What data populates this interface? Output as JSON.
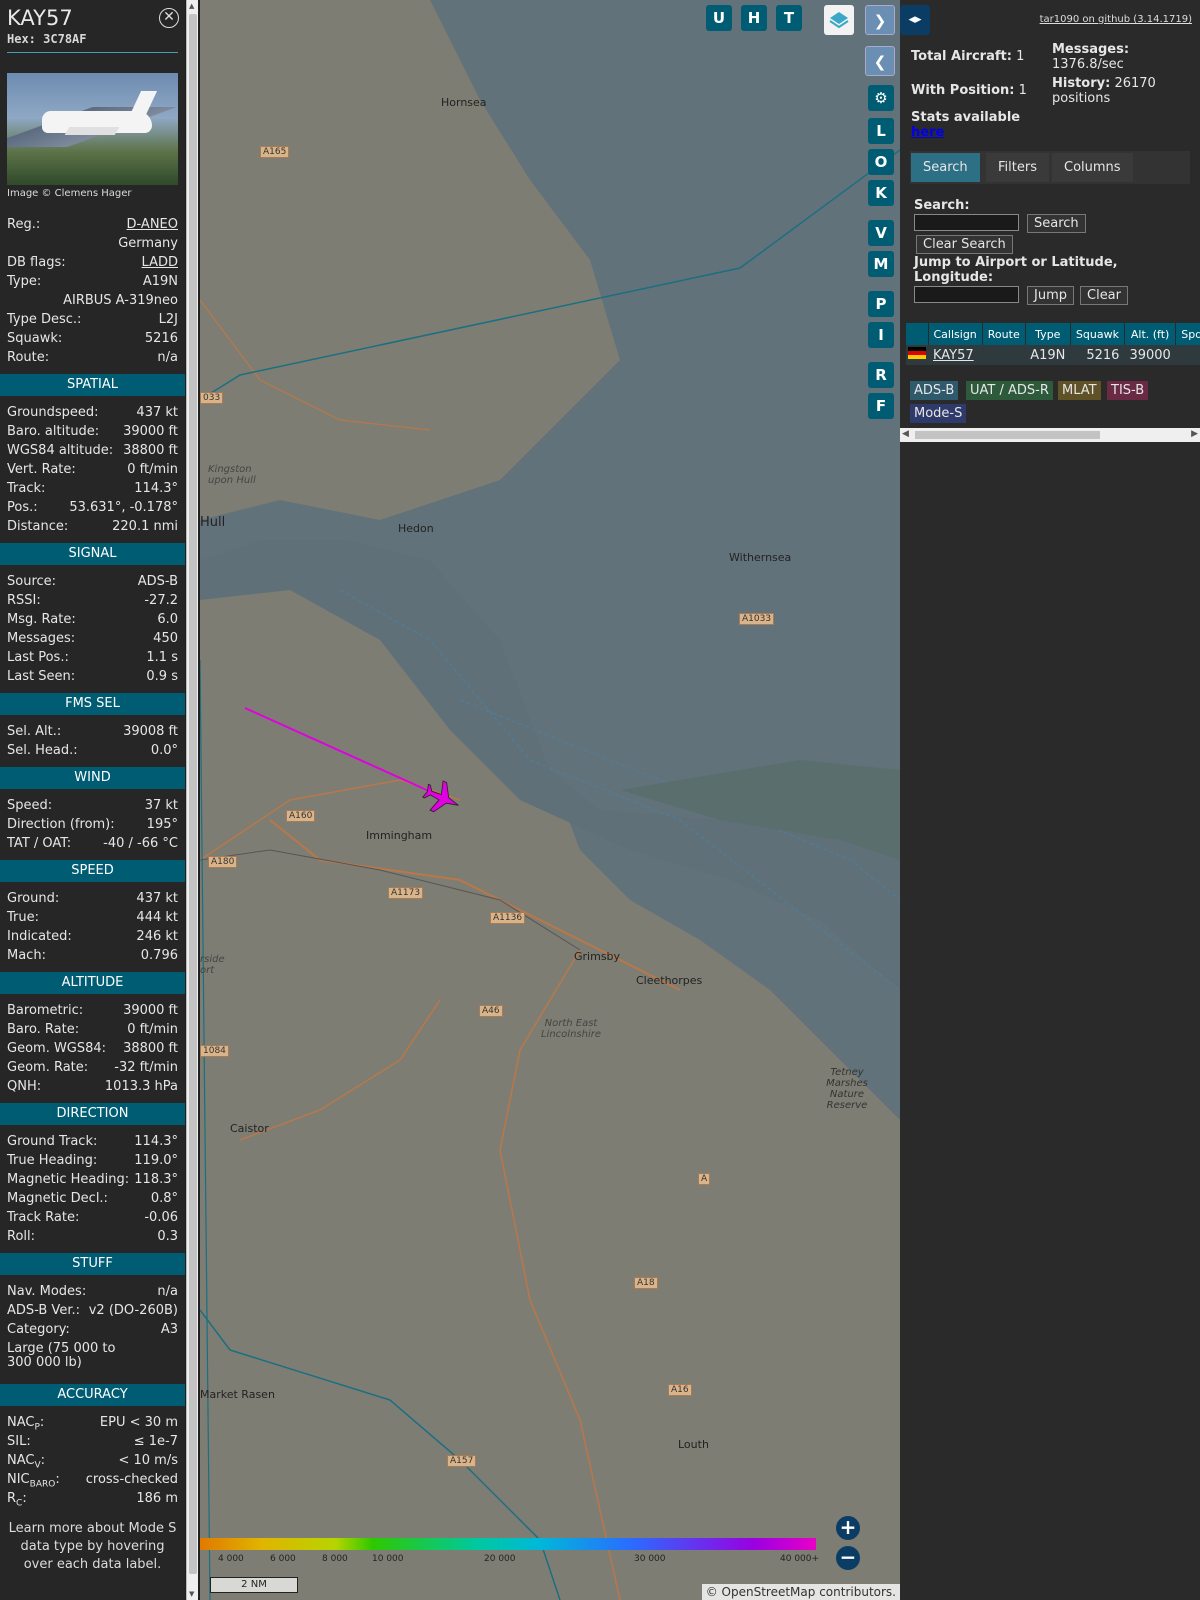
{
  "aircraft": {
    "callsign": "KAY57",
    "hex_label": "Hex:",
    "hex": "3C78AF",
    "image_credit": "Image © Clemens Hager",
    "close_icon": "close-icon"
  },
  "details": [
    {
      "k": "Reg.:",
      "v": "D-ANEO",
      "link": true
    },
    {
      "k": "",
      "v": "Germany"
    },
    {
      "k": "DB flags:",
      "v": "LADD",
      "link": true
    },
    {
      "k": "Type:",
      "v": "A19N"
    },
    {
      "k": "",
      "v": "AIRBUS A-319neo"
    },
    {
      "k": "Type Desc.:",
      "v": "L2J"
    },
    {
      "k": "Squawk:",
      "v": "5216"
    },
    {
      "k": "Route:",
      "v": "n/a"
    }
  ],
  "sections": [
    {
      "title": "SPATIAL",
      "rows": [
        {
          "k": "Groundspeed:",
          "v": "437 kt"
        },
        {
          "k": "Baro. altitude:",
          "v": "39000 ft"
        },
        {
          "k": "WGS84 altitude:",
          "v": "38800 ft"
        },
        {
          "k": "Vert. Rate:",
          "v": "0 ft/min"
        },
        {
          "k": "Track:",
          "v": "114.3°"
        },
        {
          "k": "Pos.:",
          "v": "53.631°, -0.178°"
        },
        {
          "k": "Distance:",
          "v": "220.1 nmi"
        }
      ]
    },
    {
      "title": "SIGNAL",
      "rows": [
        {
          "k": "Source:",
          "v": "ADS-B"
        },
        {
          "k": "RSSI:",
          "v": "-27.2"
        },
        {
          "k": "Msg. Rate:",
          "v": "6.0"
        },
        {
          "k": "Messages:",
          "v": "450"
        },
        {
          "k": "Last Pos.:",
          "v": "1.1 s"
        },
        {
          "k": "Last Seen:",
          "v": "0.9 s"
        }
      ]
    },
    {
      "title": "FMS SEL",
      "rows": [
        {
          "k": "Sel. Alt.:",
          "v": "39008 ft"
        },
        {
          "k": "Sel. Head.:",
          "v": "0.0°"
        }
      ]
    },
    {
      "title": "WIND",
      "rows": [
        {
          "k": "Speed:",
          "v": "37 kt"
        },
        {
          "k": "Direction (from):",
          "v": "195°"
        },
        {
          "k": "TAT / OAT:",
          "v": "-40 / -66 °C"
        }
      ]
    },
    {
      "title": "SPEED",
      "rows": [
        {
          "k": "Ground:",
          "v": "437 kt"
        },
        {
          "k": "True:",
          "v": "444 kt"
        },
        {
          "k": "Indicated:",
          "v": "246 kt"
        },
        {
          "k": "Mach:",
          "v": "0.796"
        }
      ]
    },
    {
      "title": "ALTITUDE",
      "rows": [
        {
          "k": "Barometric:",
          "v": "39000 ft"
        },
        {
          "k": "Baro. Rate:",
          "v": "0 ft/min"
        },
        {
          "k": "Geom. WGS84:",
          "v": "38800 ft"
        },
        {
          "k": "Geom. Rate:",
          "v": "-32 ft/min"
        },
        {
          "k": "QNH:",
          "v": "1013.3 hPa"
        }
      ]
    },
    {
      "title": "DIRECTION",
      "rows": [
        {
          "k": "Ground Track:",
          "v": "114.3°"
        },
        {
          "k": "True Heading:",
          "v": "119.0°"
        },
        {
          "k": "Magnetic Heading:",
          "v": "118.3°"
        },
        {
          "k": "Magnetic Decl.:",
          "v": "0.8°"
        },
        {
          "k": "Track Rate:",
          "v": "-0.06"
        },
        {
          "k": "Roll:",
          "v": "0.3"
        }
      ]
    },
    {
      "title": "STUFF",
      "rows": [
        {
          "k": "Nav. Modes:",
          "v": "n/a"
        },
        {
          "k": "ADS-B Ver.:",
          "v": "v2 (DO-260B)"
        },
        {
          "k": "Category:",
          "v": "A3"
        },
        {
          "k": "Large (75 000 to 300 000 lb)",
          "v": "",
          "tall": true
        }
      ]
    },
    {
      "title": "ACCURACY",
      "rows": [
        {
          "k": "NAC",
          "sub": "P",
          "v": "EPU < 30 m"
        },
        {
          "k": "SIL:",
          "v": "≤ 1e-7"
        },
        {
          "k": "NAC",
          "sub": "V",
          "v": "< 10 m/s"
        },
        {
          "k": "NIC",
          "sub": "BARO",
          "v": "cross-checked"
        },
        {
          "k": "R",
          "sub": "C",
          "v": "186 m"
        }
      ]
    }
  ],
  "footer_note": "Learn more about Mode S data type by hovering over each data label.",
  "map": {
    "buttons_top": [
      "U",
      "H",
      "T"
    ],
    "buttons_side": [
      "L",
      "O",
      "K",
      "V",
      "M",
      "P",
      "I",
      "R",
      "F"
    ],
    "places": [
      "Hornsea",
      "Kingston upon Hull",
      "Hull",
      "Hedon",
      "Withernsea",
      "Immingham",
      "Grimsby",
      "Cleethorpes",
      "North East Lincolnshire",
      "Caistor",
      "Tetney Marshes Nature Reserve",
      "Louth",
      "Market Rasen",
      "rside ort"
    ],
    "roads": [
      "A165",
      "033",
      "A1033",
      "A160",
      "A180",
      "A1173",
      "A1136",
      "A46",
      "1084",
      "A",
      "A18",
      "A16",
      "A157"
    ],
    "altitude_ticks": [
      "4 000",
      "6 000",
      "8 000",
      "10 000",
      "20 000",
      "30 000",
      "40 000+"
    ],
    "scale": "2 NM",
    "attribution_prefix": "© ",
    "attribution_link": "OpenStreetMap",
    "attribution_suffix": " contributors."
  },
  "right": {
    "github": "tar1090 on github (3.14.1719)",
    "total_label": "Total Aircraft:",
    "total": "1",
    "withpos_label": "With Position:",
    "withpos": "1",
    "messages_label": "Messages:",
    "messages": "1376.8/sec",
    "history_label": "History:",
    "history": "26170 positions",
    "stats_label": "Stats available",
    "stats_link": "here",
    "tabs": [
      "Search",
      "Filters",
      "Columns"
    ],
    "search_label": "Search:",
    "search_button": "Search",
    "clear_search": "Clear Search",
    "jump_label": "Jump to Airport or Latitude, Longitude:",
    "jump_button": "Jump",
    "clear_button": "Clear",
    "columns": [
      "",
      "Callsign",
      "Route",
      "Type",
      "Squawk",
      "Alt. (ft)",
      "Spd."
    ],
    "row": {
      "callsign": "KAY57",
      "route": "",
      "type": "A19N",
      "squawk": "5216",
      "alt": "39000"
    },
    "chips": [
      {
        "label": "ADS-B",
        "color": "#2f5a6c"
      },
      {
        "label": "UAT / ADS-R",
        "color": "#2e5a3c"
      },
      {
        "label": "MLAT",
        "color": "#5e5226"
      },
      {
        "label": "TIS-B",
        "color": "#6a2a43"
      },
      {
        "label": "Mode-S",
        "color": "#2e3a6a"
      }
    ]
  }
}
